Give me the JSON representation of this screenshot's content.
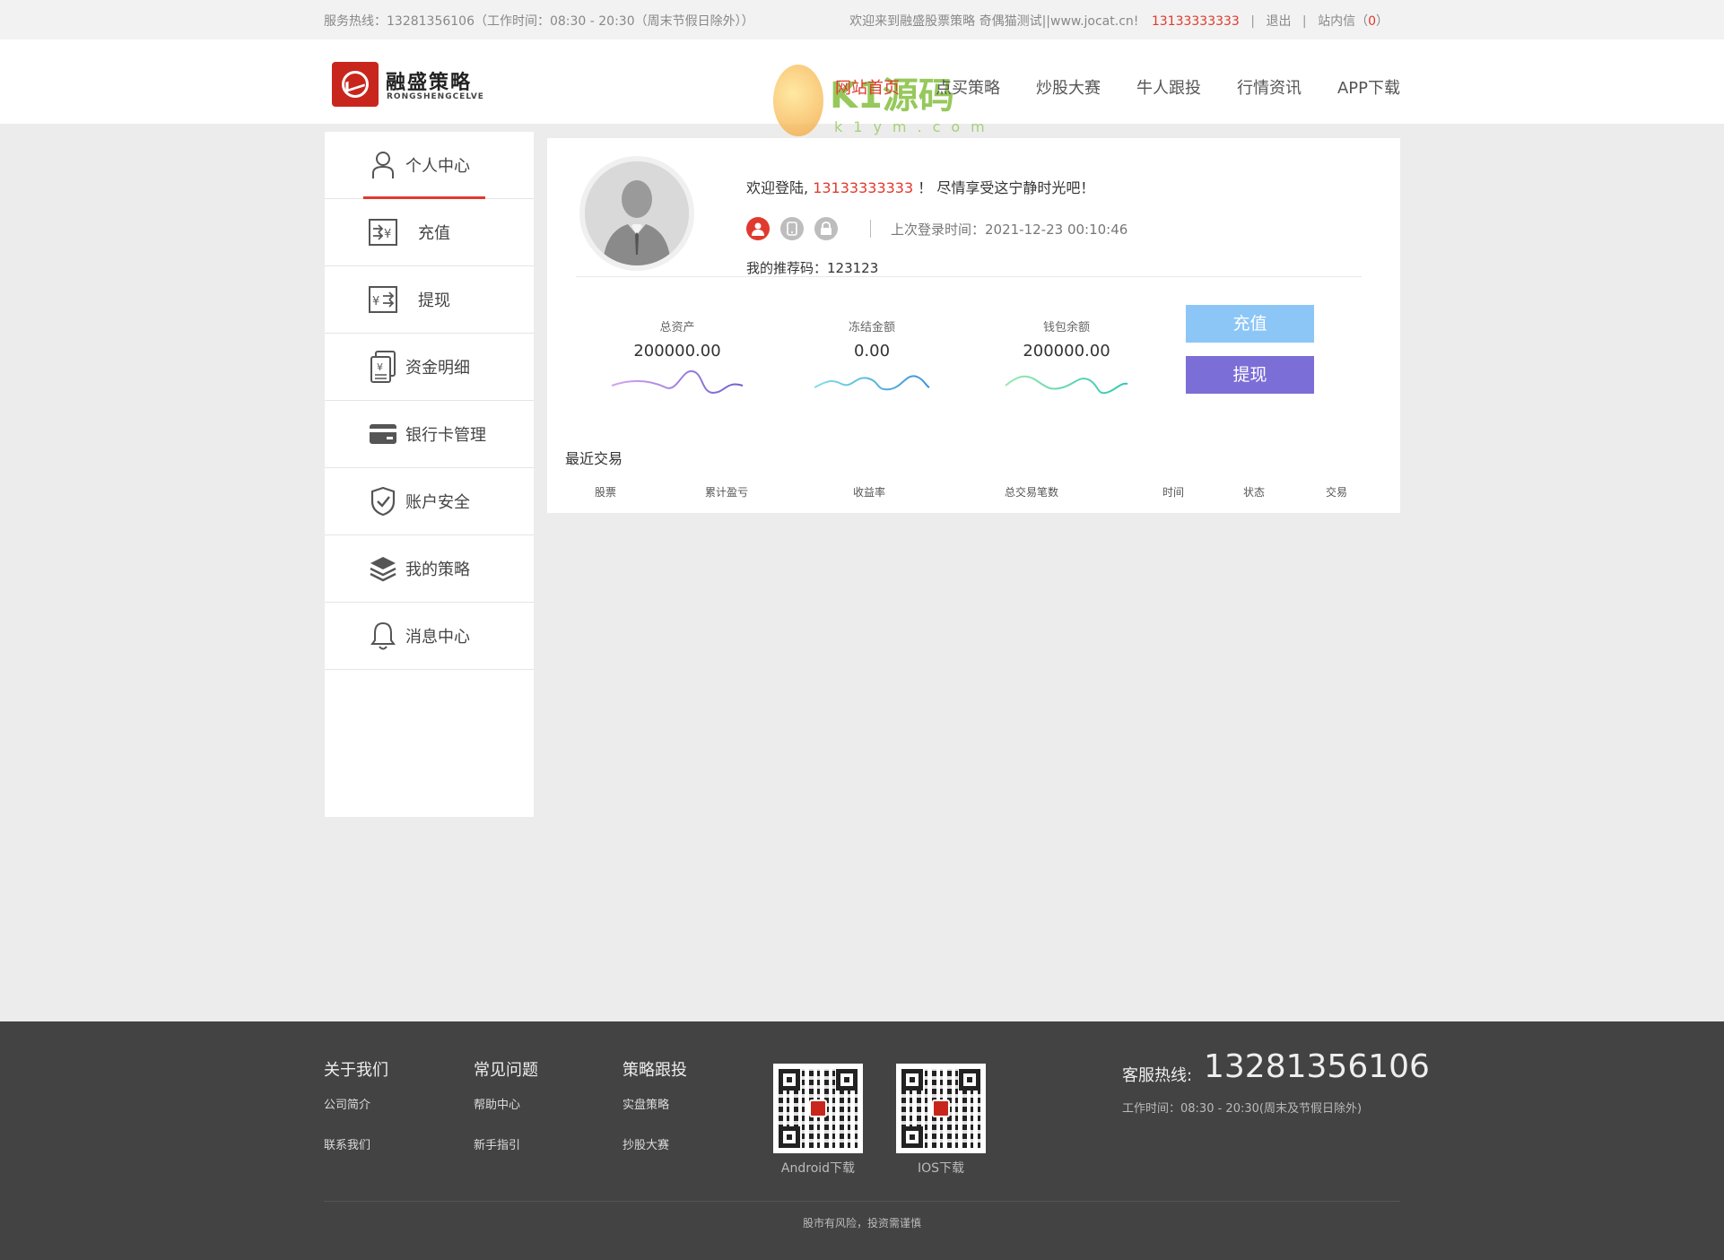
{
  "topbar": {
    "hotline": "服务热线：13281356106（工作时间：08:30 - 20:30（周末节假日除外））",
    "welcome_prefix": "欢迎来到融盛股票策略 奇偶猫测试||www.jocat.cn!",
    "phone": "13133333333",
    "sep": "|",
    "logout": "退出",
    "messages_prefix": "站内信（",
    "messages_count": "0",
    "messages_suffix": "）"
  },
  "header": {
    "brand": "融盛策略",
    "brand_sub": "RONGSHENGCELVE",
    "watermark_text": "K1源码",
    "watermark_sub": "k1ym.com",
    "nav": [
      "网站首页",
      "点买策略",
      "炒股大赛",
      "牛人跟投",
      "行情资讯",
      "APP下载"
    ],
    "nav_active_index": 0
  },
  "sidebar": {
    "items": [
      {
        "label": "个人中心",
        "icon": "user-icon"
      },
      {
        "label": "充值",
        "icon": "recharge-icon"
      },
      {
        "label": "提现",
        "icon": "withdraw-icon"
      },
      {
        "label": "资金明细",
        "icon": "fund-detail-icon"
      },
      {
        "label": "银行卡管理",
        "icon": "bank-card-icon"
      },
      {
        "label": "账户安全",
        "icon": "shield-icon"
      },
      {
        "label": "我的策略",
        "icon": "layers-icon"
      },
      {
        "label": "消息中心",
        "icon": "bell-icon"
      }
    ],
    "active_index": 0
  },
  "profile": {
    "welcome_prefix": "欢迎登陆,",
    "phone": "13133333333",
    "welcome_suffix": "！ 尽情享受这宁静时光吧！",
    "last_login": "上次登录时间：2021-12-23 00:10:46",
    "ref_code": "我的推荐码：123123"
  },
  "stats": {
    "total_assets_label": "总资产",
    "total_assets_value": "200000.00",
    "frozen_label": "冻结金额",
    "frozen_value": "0.00",
    "wallet_label": "钱包余额",
    "wallet_value": "200000.00"
  },
  "actions": {
    "recharge": "充值",
    "withdraw": "提现"
  },
  "recent": {
    "title": "最近交易",
    "columns": [
      "股票",
      "累计盈亏",
      "收益率",
      "总交易笔数",
      "时间",
      "状态",
      "交易"
    ]
  },
  "footer": {
    "cols": [
      {
        "title": "关于我们",
        "links": [
          "公司简介",
          "联系我们"
        ]
      },
      {
        "title": "常见问题",
        "links": [
          "帮助中心",
          "新手指引"
        ]
      },
      {
        "title": "策略跟投",
        "links": [
          "实盘策略",
          "抄股大赛"
        ]
      }
    ],
    "qr_android": "Android下载",
    "qr_ios": "IOS下载",
    "hotline_label": "客服热线:",
    "hotline_number": "13281356106",
    "hours": "工作时间：08:30 - 20:30(周末及节假日除外)",
    "risk": "股市有风险，投资需谨慎"
  },
  "colors": {
    "accent": "#e03a2e",
    "recharge_btn": "#8cc6f7",
    "withdraw_btn": "#7b6ed6",
    "footer_bg": "#434343"
  }
}
